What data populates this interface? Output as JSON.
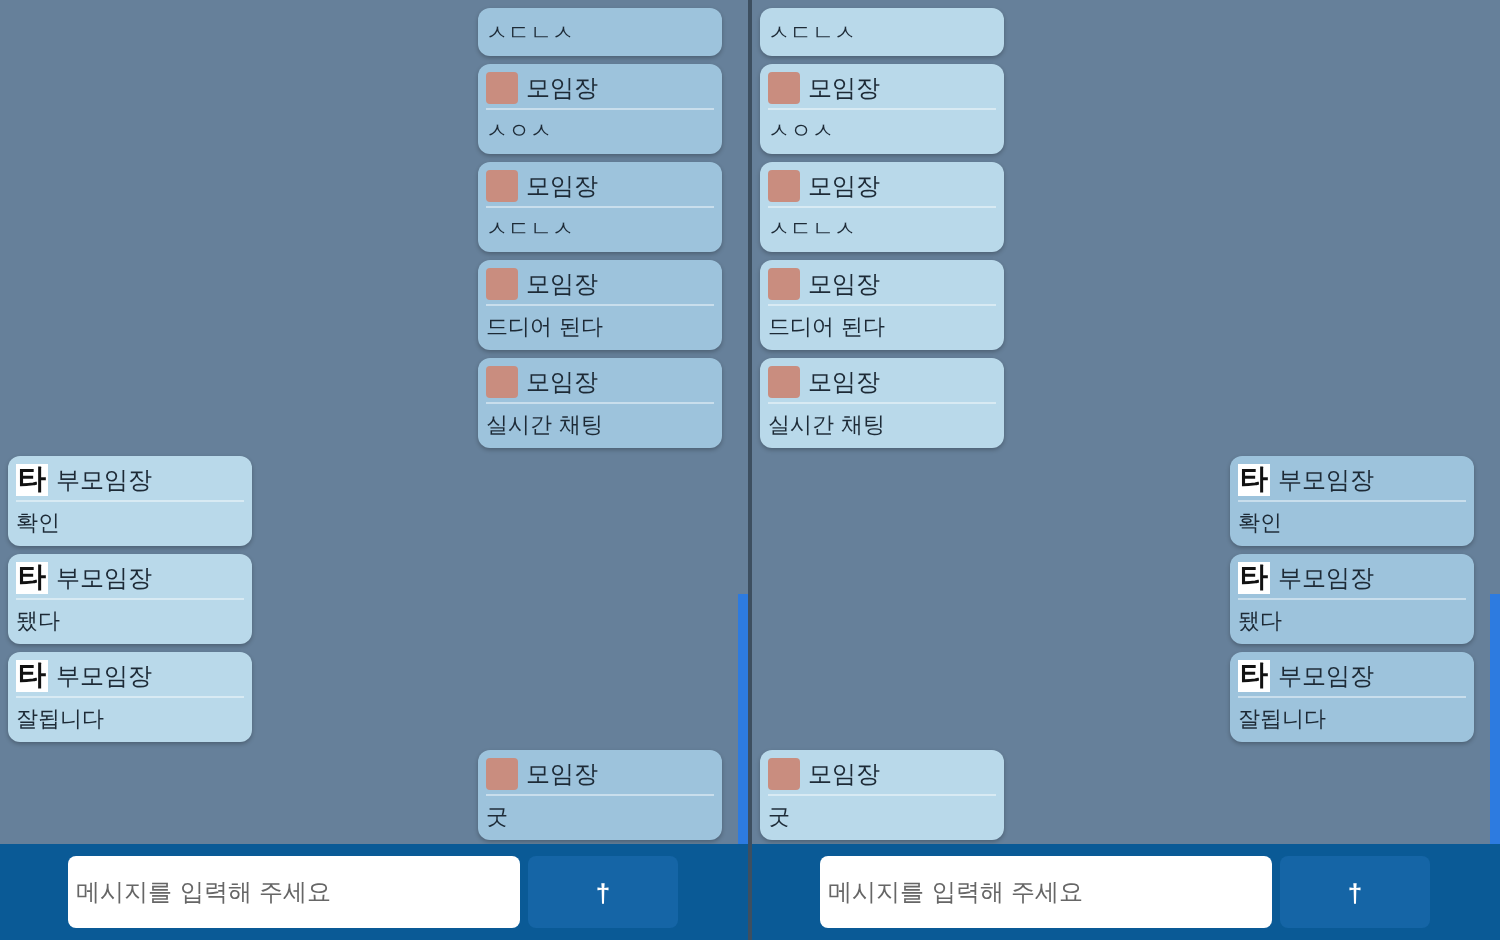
{
  "panes": [
    {
      "messages": [
        {
          "mine": true,
          "text": "ㅅㄷㄴㅅ"
        },
        {
          "mine": true,
          "sender": "모임장",
          "avatar": {
            "kind": "photo"
          },
          "text": "ㅅㅇㅅ"
        },
        {
          "mine": true,
          "sender": "모임장",
          "avatar": {
            "kind": "photo"
          },
          "text": "ㅅㄷㄴㅅ"
        },
        {
          "mine": true,
          "sender": "모임장",
          "avatar": {
            "kind": "photo"
          },
          "text": "드디어 된다"
        },
        {
          "mine": true,
          "sender": "모임장",
          "avatar": {
            "kind": "photo"
          },
          "text": "실시간 채팅"
        },
        {
          "mine": false,
          "sender": "부모임장",
          "avatar": {
            "kind": "letter",
            "text": "타"
          },
          "text": "확인"
        },
        {
          "mine": false,
          "sender": "부모임장",
          "avatar": {
            "kind": "letter",
            "text": "타"
          },
          "text": "됐다"
        },
        {
          "mine": false,
          "sender": "부모임장",
          "avatar": {
            "kind": "letter",
            "text": "타"
          },
          "text": "잘됩니다"
        },
        {
          "mine": true,
          "sender": "모임장",
          "avatar": {
            "kind": "photo"
          },
          "text": "굿"
        }
      ],
      "input": {
        "placeholder": "메시지를 입력해 주세요"
      },
      "send": "†"
    },
    {
      "messages": [
        {
          "mine": false,
          "text": "ㅅㄷㄴㅅ"
        },
        {
          "mine": false,
          "sender": "모임장",
          "avatar": {
            "kind": "photo"
          },
          "text": "ㅅㅇㅅ"
        },
        {
          "mine": false,
          "sender": "모임장",
          "avatar": {
            "kind": "photo"
          },
          "text": "ㅅㄷㄴㅅ"
        },
        {
          "mine": false,
          "sender": "모임장",
          "avatar": {
            "kind": "photo"
          },
          "text": "드디어 된다"
        },
        {
          "mine": false,
          "sender": "모임장",
          "avatar": {
            "kind": "photo"
          },
          "text": "실시간 채팅"
        },
        {
          "mine": true,
          "sender": "부모임장",
          "avatar": {
            "kind": "letter",
            "text": "타"
          },
          "text": "확인"
        },
        {
          "mine": true,
          "sender": "부모임장",
          "avatar": {
            "kind": "letter",
            "text": "타"
          },
          "text": "됐다"
        },
        {
          "mine": true,
          "sender": "부모임장",
          "avatar": {
            "kind": "letter",
            "text": "타"
          },
          "text": "잘됩니다"
        },
        {
          "mine": false,
          "sender": "모임장",
          "avatar": {
            "kind": "photo"
          },
          "text": "굿"
        }
      ],
      "input": {
        "placeholder": "메시지를 입력해 주세요"
      },
      "send": "†"
    }
  ]
}
